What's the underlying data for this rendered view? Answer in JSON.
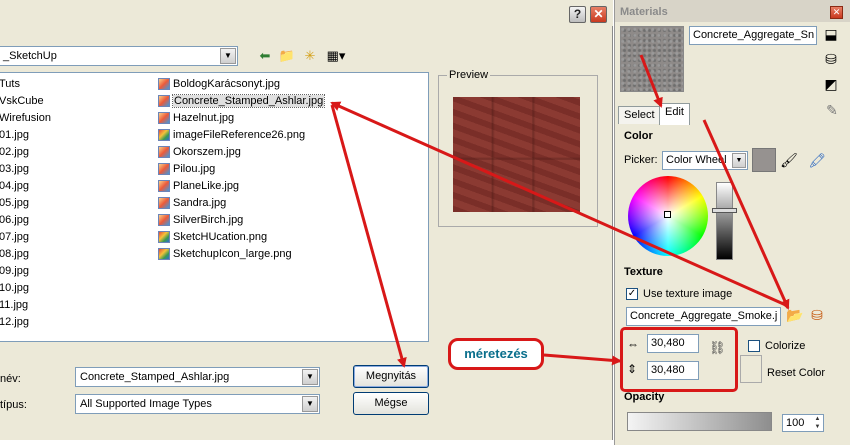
{
  "dialog": {
    "help_glyph": "?",
    "close_glyph": "✕",
    "look_in_value": "_SketchUp",
    "left_column": [
      "Tuts",
      "VskCube",
      "Wirefusion",
      "01.jpg",
      "02.jpg",
      "03.jpg",
      "04.jpg",
      "05.jpg",
      "06.jpg",
      "07.jpg",
      "08.jpg",
      "09.jpg",
      "10.jpg",
      "11.jpg",
      "12.jpg"
    ],
    "files": [
      {
        "name": "BoldogKarácsonyt.jpg",
        "type": "jpg"
      },
      {
        "name": "Concrete_Stamped_Ashlar.jpg",
        "type": "jpg",
        "selected": true
      },
      {
        "name": "Hazelnut.jpg",
        "type": "jpg"
      },
      {
        "name": "imageFileReference26.png",
        "type": "png"
      },
      {
        "name": "Okorszem.jpg",
        "type": "jpg"
      },
      {
        "name": "Pilou.jpg",
        "type": "jpg"
      },
      {
        "name": "PlaneLike.jpg",
        "type": "jpg"
      },
      {
        "name": "Sandra.jpg",
        "type": "jpg"
      },
      {
        "name": "SilverBirch.jpg",
        "type": "jpg"
      },
      {
        "name": "SketcHUcation.png",
        "type": "png"
      },
      {
        "name": "SketchupIcon_large.png",
        "type": "png"
      }
    ],
    "preview_label": "Preview",
    "filename_label": "név:",
    "filename_value": "Concrete_Stamped_Ashlar.jpg",
    "filetype_label": "típus:",
    "filetype_value": "All Supported Image Types",
    "open_button": "Megnyitás",
    "cancel_button": "Mégse"
  },
  "materials": {
    "title": "Materials",
    "close_glyph": "✕",
    "material_name": "Concrete_Aggregate_Sn",
    "tabs": [
      "Select",
      "Edit"
    ],
    "color_section": "Color",
    "picker_label": "Picker:",
    "picker_value": "Color Wheel",
    "texture_section": "Texture",
    "use_texture_label": "Use texture image",
    "texture_file": "Concrete_Aggregate_Smoke.j",
    "width_value": "30,480",
    "height_value": "30,480",
    "colorize_label": "Colorize",
    "reset_color_label": "Reset Color",
    "opacity_section": "Opacity",
    "opacity_value": "100"
  },
  "annotation": {
    "callout_text": "méretezés",
    "accent_color": "#d81818"
  }
}
